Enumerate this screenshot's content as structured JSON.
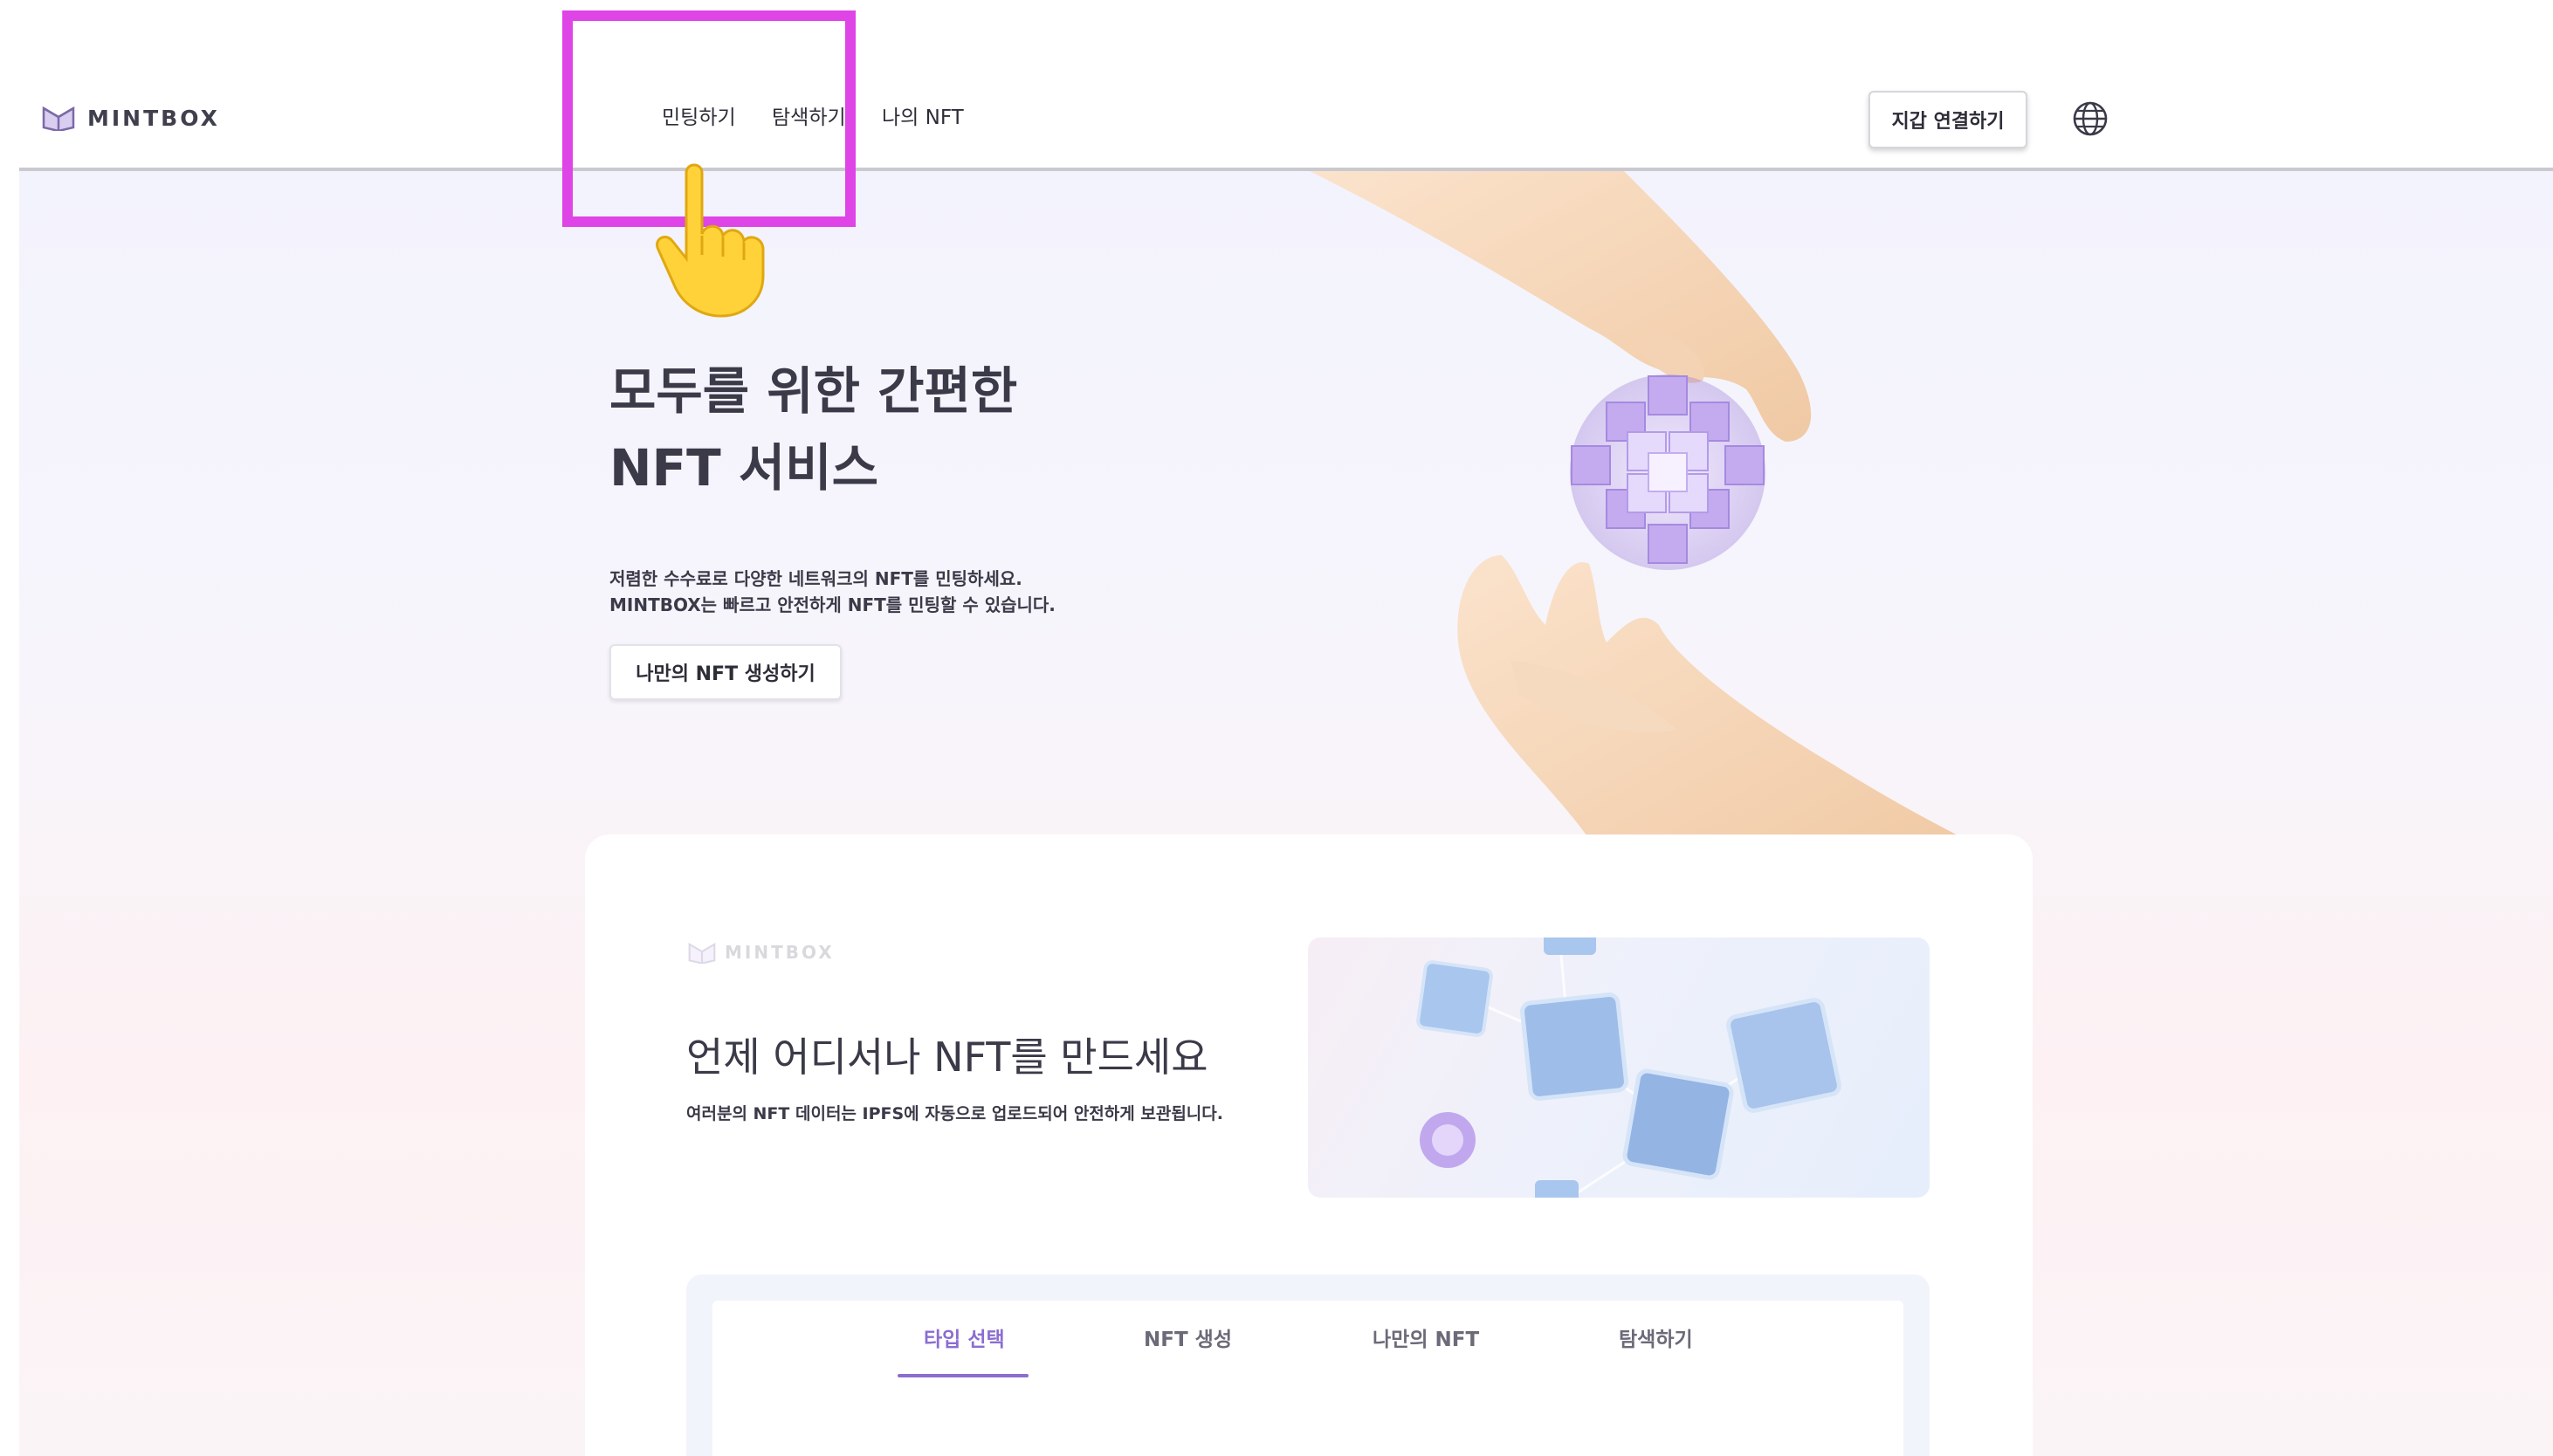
{
  "header": {
    "logo_text": "MINTBOX",
    "nav": [
      "민팅하기",
      "탐색하기",
      "나의 NFT"
    ],
    "wallet_button": "지갑 연결하기",
    "language_icon": "globe-icon"
  },
  "hero": {
    "title_line1": "모두를 위한 간편한",
    "title_line2": "NFT 서비스",
    "desc_line1": "저렴한 수수료로 다양한 네트워크의 NFT를 민팅하세요.",
    "desc_line2": "MINTBOX는 빠르고 안전하게 NFT를 민팅할 수 있습니다.",
    "cta_button": "나만의 NFT 생성하기"
  },
  "card": {
    "logo_text": "MINTBOX",
    "title": "언제 어디서나 NFT를 만드세요",
    "subtitle": "여러분의 NFT 데이터는 IPFS에 자동으로 업로드되어 안전하게 보관됩니다."
  },
  "tabs": [
    {
      "label": "타입 선택",
      "active": true
    },
    {
      "label": "NFT 생성",
      "active": false
    },
    {
      "label": "나만의 NFT",
      "active": false
    },
    {
      "label": "탐색하기",
      "active": false
    }
  ],
  "colors": {
    "accent": "#8b6dd0",
    "highlight": "#df44e6",
    "text": "#3a3a48"
  }
}
